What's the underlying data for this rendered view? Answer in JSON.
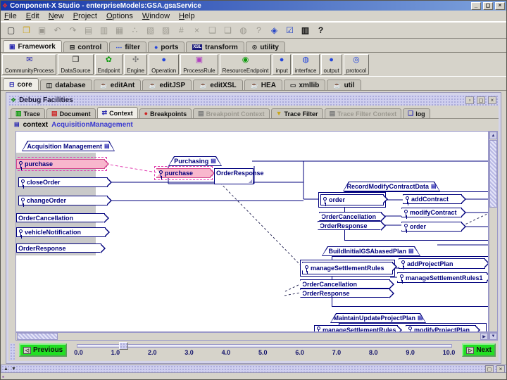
{
  "window": {
    "icon_glyph": "❖",
    "title": "Component-X Studio - enterpriseModels:GSA.gsaService",
    "minimize": "_",
    "restore": "◻",
    "close": "×"
  },
  "menubar": [
    "File",
    "Edit",
    "New",
    "Project",
    "Options",
    "Window",
    "Help"
  ],
  "toolbar": [
    {
      "name": "new-file",
      "glyph": "▢"
    },
    {
      "name": "open-file",
      "glyph": "❒"
    },
    {
      "name": "save",
      "glyph": "▣"
    },
    {
      "name": "undo",
      "glyph": "↶"
    },
    {
      "name": "redo",
      "glyph": "↷"
    },
    {
      "name": "add-component",
      "glyph": "▤"
    },
    {
      "name": "edit-component",
      "glyph": "▥"
    },
    {
      "name": "remove-component",
      "glyph": "▦"
    },
    {
      "name": "add-port",
      "glyph": "∴"
    },
    {
      "name": "add-frame",
      "glyph": "▧"
    },
    {
      "name": "add-view",
      "glyph": "▨"
    },
    {
      "name": "stamp",
      "glyph": "#"
    },
    {
      "name": "delete",
      "glyph": "×"
    },
    {
      "name": "copy",
      "glyph": "❏"
    },
    {
      "name": "paste",
      "glyph": "❑"
    },
    {
      "name": "globe",
      "glyph": "◍"
    },
    {
      "name": "context-help",
      "glyph": "?"
    },
    {
      "name": "wizard",
      "glyph": "◈"
    },
    {
      "name": "validate",
      "glyph": "☑"
    },
    {
      "name": "console",
      "glyph": "▥"
    },
    {
      "name": "help",
      "glyph": "?"
    }
  ],
  "component_tabs": [
    {
      "label": "Framework",
      "glyph": "▣"
    },
    {
      "label": "control",
      "glyph": "⊟"
    },
    {
      "label": "filter",
      "glyph": "⋯"
    },
    {
      "label": "ports",
      "glyph": "●"
    },
    {
      "label": "transform",
      "glyph": "",
      "badge": "XSL"
    },
    {
      "label": "utility",
      "glyph": "⊙"
    }
  ],
  "palette": [
    {
      "label": "CommunityProcess",
      "glyph": "✉"
    },
    {
      "label": "DataSource",
      "glyph": "❒"
    },
    {
      "label": "Endpoint",
      "glyph": "✿"
    },
    {
      "label": "Engine",
      "glyph": "✣"
    },
    {
      "label": "Operation",
      "glyph": "●"
    },
    {
      "label": "ProcessRule",
      "glyph": "▣"
    },
    {
      "label": "ResourceEndpoint",
      "glyph": "◉"
    },
    {
      "label": "input",
      "glyph": "●"
    },
    {
      "label": "interface",
      "glyph": "◍"
    },
    {
      "label": "output",
      "glyph": "●"
    },
    {
      "label": "protocol",
      "glyph": "◎"
    }
  ],
  "library_tabs": [
    {
      "label": "core",
      "glyph": "⊟"
    },
    {
      "label": "database",
      "glyph": "◫"
    },
    {
      "label": "editAnt",
      "glyph": "☕"
    },
    {
      "label": "editJSP",
      "glyph": "☕"
    },
    {
      "label": "editXSL",
      "glyph": "☕"
    },
    {
      "label": "HEA",
      "glyph": "☕"
    },
    {
      "label": "xmllib",
      "glyph": "▭"
    },
    {
      "label": "util",
      "glyph": "☕"
    }
  ],
  "debug": {
    "title": "Debug Facilities",
    "controls": {
      "minimize": "▫",
      "maximize": "◻",
      "close": "×"
    },
    "tabs": [
      {
        "label": "Trace",
        "glyph": "▥"
      },
      {
        "label": "Document",
        "glyph": "▤"
      },
      {
        "label": "Context",
        "glyph": "⇄"
      },
      {
        "label": "Breakpoints",
        "glyph": "●"
      },
      {
        "label": "Breakpoint Context",
        "glyph": "▤"
      },
      {
        "label": "Trace Filter",
        "glyph": "▼"
      },
      {
        "label": "Trace Filter Context",
        "glyph": "▤"
      },
      {
        "label": "log",
        "glyph": "❏"
      }
    ],
    "context_label": "context",
    "context_value": "AcquisitionManagement",
    "previous": "Previous",
    "next": "Next",
    "prev_icon": "◁",
    "next_icon": "▷",
    "ticks": [
      "0.0",
      "1.0",
      "2.0",
      "3.0",
      "4.0",
      "5.0",
      "6.0",
      "7.0",
      "8.0",
      "9.0",
      "10.0"
    ]
  },
  "diagram": {
    "folder_glyph": "▤",
    "groups": {
      "acquisition": {
        "title": "Acquisition Management",
        "items": [
          "purchase",
          "closeOrder",
          "changeOrder",
          "OrderCancellation",
          "vehicleNotification",
          "OrderResponse"
        ]
      },
      "purchasing": {
        "title": "Purchasing",
        "items": [
          "purchase",
          "OrderResponse"
        ]
      },
      "record": {
        "title": "RecordModifyContractData",
        "left": [
          "order",
          "OrderCancellation",
          "OrderResponse"
        ],
        "right": [
          "addContract",
          "modifyContract",
          "order"
        ]
      },
      "build": {
        "title": "BuildInitialGSAbasedPlan",
        "left": [
          "manageSettlementRules",
          "OrderCancellation",
          "OrderResponse"
        ],
        "right": [
          "addProjectPlan",
          "manageSettlementRules1"
        ]
      },
      "maintain": {
        "title": "MaintainUpdateProjectPlan",
        "left": [
          "manageSettlementRules"
        ],
        "right": [
          "modifyProjectPlan"
        ]
      }
    }
  },
  "colors": {
    "titlebar_start": "#1636a8",
    "titlebar_end": "#7da2dc",
    "chrome": "#d6d3ca",
    "box_border": "#00007d",
    "selection_pink": "#f8b7cd",
    "selection_magenta": "#e23bb0",
    "nav_green": "#22df22",
    "frame_lavender": "#cfcfef"
  }
}
